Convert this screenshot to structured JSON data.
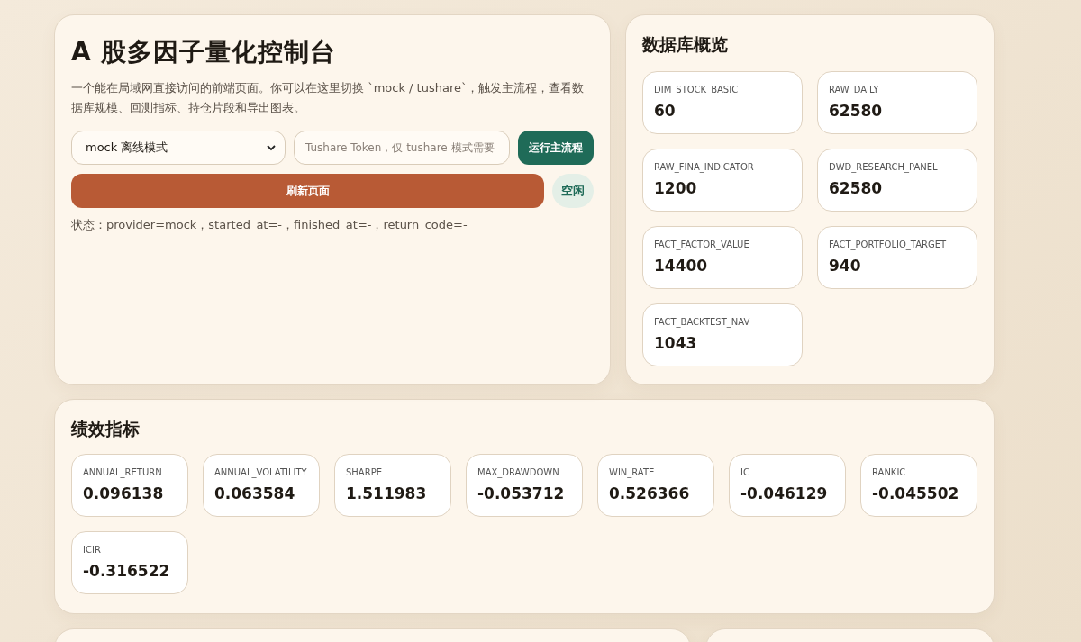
{
  "control_panel": {
    "title": "A 股多因子量化控制台",
    "description": "一个能在局域网直接访问的前端页面。你可以在这里切换 `mock / tushare`，触发主流程，查看数据库规模、回测指标、持仓片段和导出图表。",
    "mode_select": {
      "value": "mock 离线模式"
    },
    "token_field": {
      "placeholder": "Tushare Token，仅 tushare 模式需要"
    },
    "run_button": "运行主流程",
    "refresh_button": "刷新页面",
    "status_badge": "空闲",
    "status_line": "状态：provider=mock，started_at=-，finished_at=-，return_code=-"
  },
  "database_overview": {
    "title": "数据库概览",
    "tables": [
      {
        "name": "DIM_STOCK_BASIC",
        "count": "60"
      },
      {
        "name": "RAW_DAILY",
        "count": "62580"
      },
      {
        "name": "RAW_FINA_INDICATOR",
        "count": "1200"
      },
      {
        "name": "DWD_RESEARCH_PANEL",
        "count": "62580"
      },
      {
        "name": "FACT_FACTOR_VALUE",
        "count": "14400"
      },
      {
        "name": "FACT_PORTFOLIO_TARGET",
        "count": "940"
      },
      {
        "name": "FACT_BACKTEST_NAV",
        "count": "1043"
      }
    ]
  },
  "performance": {
    "title": "绩效指标",
    "metrics": [
      {
        "name": "ANNUAL_RETURN",
        "value": "0.096138"
      },
      {
        "name": "ANNUAL_VOLATILITY",
        "value": "0.063584"
      },
      {
        "name": "SHARPE",
        "value": "1.511983"
      },
      {
        "name": "MAX_DRAWDOWN",
        "value": "-0.053712"
      },
      {
        "name": "WIN_RATE",
        "value": "0.526366"
      },
      {
        "name": "IC",
        "value": "-0.046129"
      },
      {
        "name": "RANKIC",
        "value": "-0.045502"
      },
      {
        "name": "ICIR",
        "value": "-0.316522"
      }
    ]
  }
}
